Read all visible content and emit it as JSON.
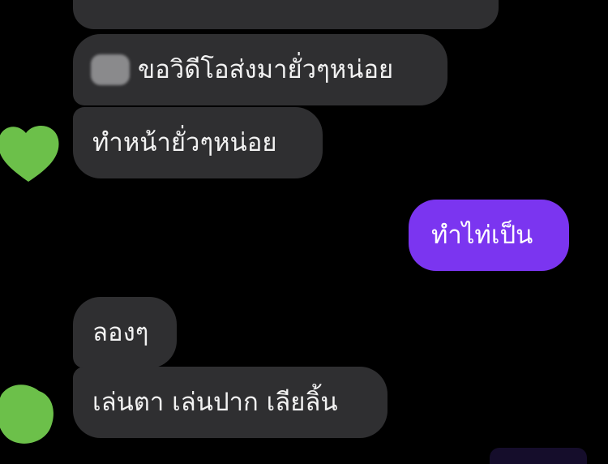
{
  "conversation": {
    "messages": [
      {
        "side": "incoming",
        "text": "ขอวิดีโอส่งมายั่วๆหน่อย",
        "has_redacted_emoji": true
      },
      {
        "side": "incoming",
        "text": "ทำหน้ายั่วๆหน่อย"
      },
      {
        "side": "outgoing",
        "text": "ทำไท่เป็น"
      },
      {
        "side": "incoming",
        "text": "ลองๆ"
      },
      {
        "side": "incoming",
        "text": "เล่นตา เล่นปาก เลียลิ้น"
      }
    ]
  },
  "colors": {
    "background": "#000000",
    "incoming_bubble": "#2f2f31",
    "outgoing_bubble": "#7b35f0",
    "avatar_redaction": "#6cc04a"
  }
}
